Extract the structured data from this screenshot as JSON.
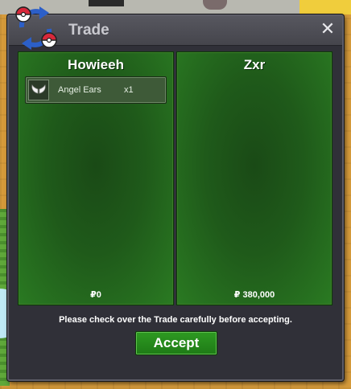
{
  "window": {
    "title": "Trade",
    "close_label": "✕"
  },
  "left_panel": {
    "name": "Howieeh",
    "items": [
      {
        "name": "Angel Ears",
        "qty": "x1",
        "icon": "angel-ears-icon"
      }
    ],
    "money": "₽0"
  },
  "right_panel": {
    "name": "Zxr",
    "items": [],
    "money": "₽ 380,000"
  },
  "notice": "Please check over the Trade carefully before accepting.",
  "accept_label": "Accept",
  "colors": {
    "panel_green": "#1f5a1a",
    "accept_green": "#2e9a22",
    "window_bg": "#303038",
    "logo_red": "#d8283a",
    "logo_blue": "#2c5fc8"
  }
}
